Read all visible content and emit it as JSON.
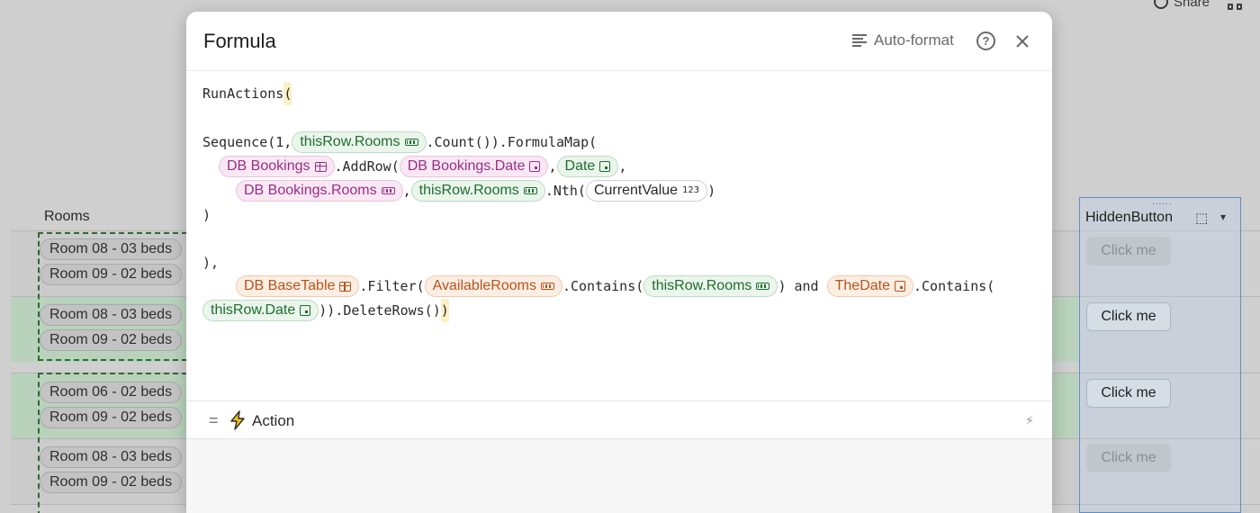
{
  "background": {
    "topbar": {
      "share_label": "Share"
    },
    "rooms_column_header": "Rooms",
    "hidden_button_column_header": "HiddenButton",
    "rows": [
      {
        "rooms": [
          "Room 08 - 03 beds",
          "Room 09 - 02 beds"
        ],
        "button": "Click me",
        "button_state": "disabled",
        "highlight": false
      },
      {
        "rooms": [
          "Room 08 - 03 beds",
          "Room 09 - 02 beds"
        ],
        "button": "Click me",
        "button_state": "enabled",
        "highlight": true
      },
      {
        "rooms": [
          "Room 06 - 02 beds",
          "Room 09 - 02 beds"
        ],
        "button": "Click me",
        "button_state": "enabled",
        "highlight": true
      },
      {
        "rooms": [
          "Room 08 - 03 beds",
          "Room 09 - 02 beds"
        ],
        "button": "Click me",
        "button_state": "disabled",
        "highlight": false
      }
    ]
  },
  "modal": {
    "title": "Formula",
    "autoformat_label": "Auto-format",
    "help_glyph": "?",
    "code": {
      "l1_fn": "RunActions",
      "l1_paren": "(",
      "l2_a": "Sequence(1,",
      "l2_tok": "thisRow.Rooms",
      "l2_b": ".Count()).FormulaMap(",
      "l3_tok1": "DB Bookings",
      "l3_a": ".AddRow(",
      "l3_tok2": "DB Bookings.Date",
      "l3_b": ",",
      "l3_tok3": "Date",
      "l3_c": ",",
      "l4_tok1": "DB Bookings.Rooms",
      "l4_a": ",",
      "l4_tok2": "thisRow.Rooms",
      "l4_b": ".Nth(",
      "l4_tok3": "CurrentValue",
      "l4_num_icon": "123",
      "l4_c": ")",
      "l5": ")",
      "l6": "),",
      "l7_tok1": "DB BaseTable",
      "l7_a": ".Filter(",
      "l7_tok2": "AvailableRooms",
      "l7_b": ".Contains(",
      "l7_tok3": "thisRow.Rooms",
      "l7_c": ") and",
      "l7_tok4": "TheDate",
      "l7_d": ".Contains(",
      "l8_tok1": "thisRow.Date",
      "l8_a": ")).DeleteRows()",
      "l8_paren": ")"
    },
    "result_type": {
      "equals": "=",
      "label": "Action"
    }
  },
  "colors": {
    "column_ref": "#1e6e2c",
    "table_ref": "#9a2d85",
    "filter_ref": "#b9521a",
    "row_highlight": "#b8d2bc",
    "selection_border": "#5d8fc7"
  }
}
